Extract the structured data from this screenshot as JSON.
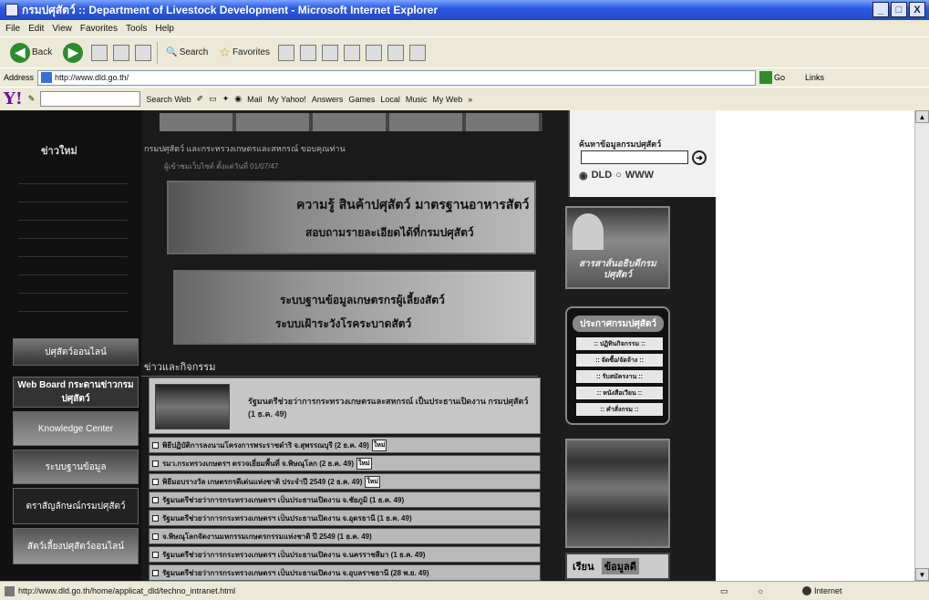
{
  "window": {
    "title": "กรมปศุสัตว์ :: Department of Livestock Development - Microsoft Internet Explorer",
    "buttons": [
      "_",
      "□",
      "X"
    ]
  },
  "menu": [
    "File",
    "Edit",
    "View",
    "Favorites",
    "Tools",
    "Help"
  ],
  "toolbar": {
    "back_label": "Back",
    "search_label": "Search",
    "favorites_label": "Favorites"
  },
  "address": {
    "label": "Address",
    "url": "http://www.dld.go.th/",
    "go_label": "Go",
    "links_label": "Links"
  },
  "yahoo_toolbar": {
    "logo": "Y!",
    "search_web": "Search Web",
    "items": [
      "Mail",
      "My Yahoo!",
      "Answers",
      "Games",
      "Local",
      "Music",
      "My Web"
    ]
  },
  "page": {
    "left_header": "ข่าวใหม่",
    "intro_text": "กรมปศุสัตว์ และกระทรวงเกษตรและสหกรณ์ ขอบคุณท่าน",
    "intro_sub": "ผู้เข้าชมเว็บไซต์ ตั้งแต่วันที่ 01/07/47",
    "banner1_line1": "ความรู้ สินค้าปศุสัตว์ มาตรฐานอาหารสัตว์",
    "banner1_line2": "สอบถามรายละเอียดได้ที่กรมปศุสัตว์",
    "banner2_line1": "ระบบฐานข้อมูลเกษตรกรผู้เลี้ยงสัตว์",
    "banner2_line2": "ระบบเฝ้าระวังโรคระบาดสัตว์",
    "left_buttons": [
      "ปศุสัตว์ออนไลน์",
      "Web Board กระดานข่าวกรมปศุสัตว์",
      "Knowledge Center",
      "ระบบฐานข้อมูล",
      "ตราสัญลักษณ์กรมปศุสัตว์",
      "สัตว์เลี้ยงปศุสัตว์ออนไลน์"
    ],
    "news_header": "ข่าวและกิจกรรม",
    "featured_news": "รัฐมนตรีช่วยว่าการกระทรวงเกษตรและสหกรณ์ เป็นประธานเปิดงาน กรมปศุสัตว์ (1 ธ.ค. 49)",
    "news_items": [
      {
        "text": "พิธีปฏิบัติการลงนามโครงการพระราชดำริ จ.สุพรรณบุรี (2 ธ.ค. 49)",
        "tag": "ใหม่"
      },
      {
        "text": "รมว.กระทรวงเกษตรฯ ตรวจเยี่ยมพื้นที่ จ.พิษณุโลก (2 ธ.ค. 49)",
        "tag": "ใหม่"
      },
      {
        "text": "พิธีมอบรางวัล เกษตรกรดีเด่นแห่งชาติ ประจำปี 2549 (2 ธ.ค. 49)",
        "tag": "ใหม่"
      },
      {
        "text": "รัฐมนตรีช่วยว่าการกระทรวงเกษตรฯ เป็นประธานเปิดงาน จ.ชัยภูมิ (1 ธ.ค. 49)",
        "tag": ""
      },
      {
        "text": "รัฐมนตรีช่วยว่าการกระทรวงเกษตรฯ เป็นประธานเปิดงาน จ.อุดรธานี (1 ธ.ค. 49)",
        "tag": ""
      },
      {
        "text": "จ.พิษณุโลกจัดงานมหกรรมเกษตรกรรมแห่งชาติ ปี 2549 (1 ธ.ค. 49)",
        "tag": ""
      },
      {
        "text": "รัฐมนตรีช่วยว่าการกระทรวงเกษตรฯ เป็นประธานเปิดงาน จ.นครราชสีมา (1 ธ.ค. 49)",
        "tag": ""
      },
      {
        "text": "รัฐมนตรีช่วยว่าการกระทรวงเกษตรฯ เป็นประธานเปิดงาน จ.อุบลราชธานี (28 พ.ย. 49)",
        "tag": ""
      }
    ],
    "search_label": "ค้นหาข้อมูลกรมปศุสัตว์",
    "search_opt1": "DLD",
    "search_opt2": "WWW",
    "right_box1": "สารสาส์นอธิบดีกรมปศุสัตว์",
    "right_box2_title": "ประกาศกรมปศุสัตว์",
    "right_box2_links": [
      ":: ปฏิทินกิจกรรม ::",
      ":: จัดซื้อ/จัดจ้าง ::",
      ":: รับสมัครงาน ::",
      ":: หนังสือเวียน ::",
      ":: คำสั่งกรม ::"
    ],
    "right_bottom": [
      "เรียน",
      "ข้อมูลดี"
    ]
  },
  "status": {
    "url": "http://www.dld.go.th/home/applicat_dld/techno_intranet.html",
    "zone": "Internet"
  }
}
